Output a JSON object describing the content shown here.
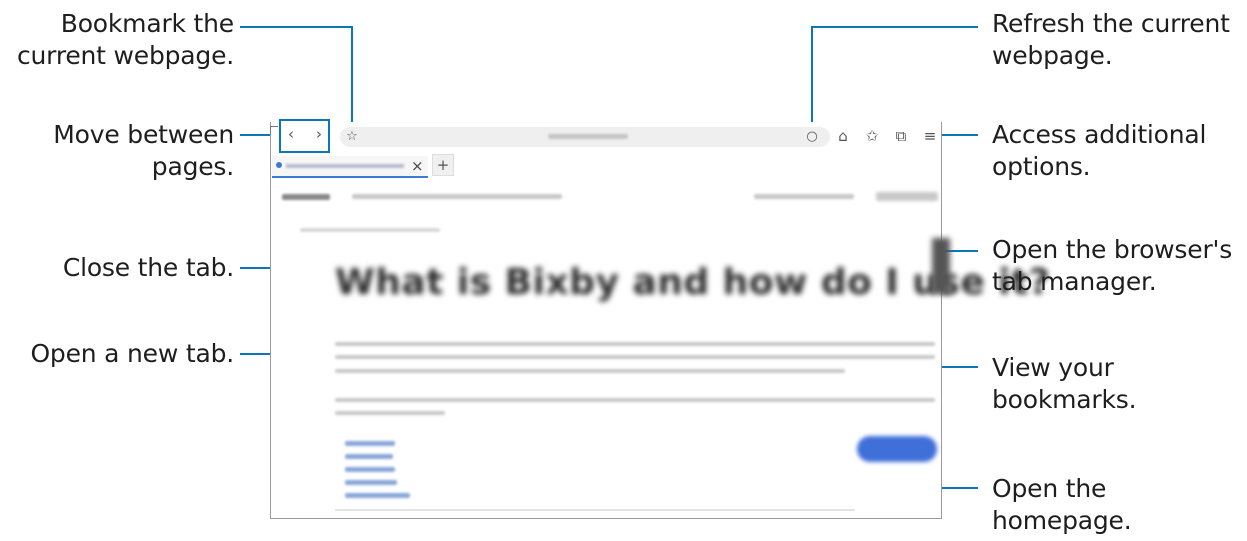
{
  "callouts": {
    "bookmark_current": "Bookmark the\ncurrent webpage.",
    "move_between_pages": "Move between\npages.",
    "close_tab": "Close the tab.",
    "open_new_tab": "Open a new tab.",
    "refresh": "Refresh the current\nwebpage.",
    "additional_options": "Access additional\noptions.",
    "tab_manager": "Open the browser's\ntab manager.",
    "view_bookmarks": "View your\nbookmarks.",
    "open_homepage": "Open the\nhomepage."
  },
  "toolbar_icons": {
    "back": "‹",
    "forward": "›",
    "bookmark": "☆",
    "refresh": "○",
    "home": "⌂",
    "bookmarks": "✩",
    "tabs": "⧉",
    "menu": "≡",
    "close_tab": "×",
    "new_tab": "+"
  },
  "page_headline": "What is Bixby and how do I use it?",
  "colors": {
    "callout_line": "#0a78b8",
    "link": "#3f6fd8"
  }
}
